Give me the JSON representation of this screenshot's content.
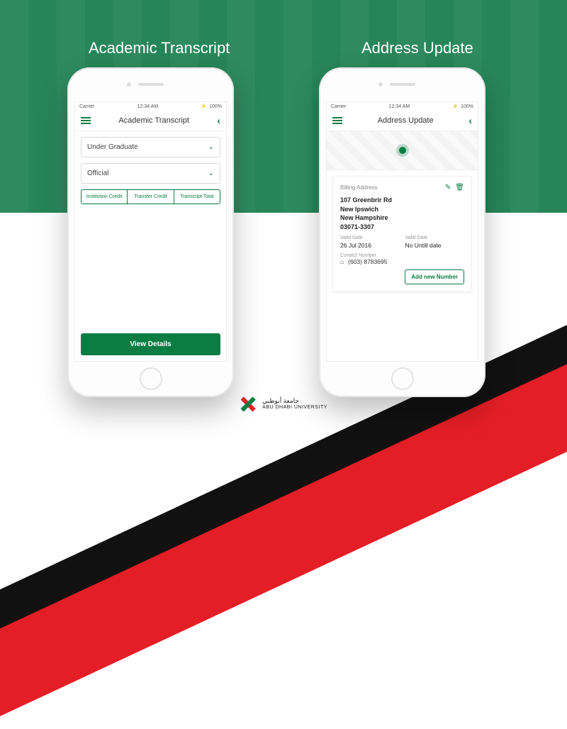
{
  "titles": {
    "left": "Academic Transcript",
    "right": "Address Update"
  },
  "status": {
    "carrier": "Carrier",
    "wifi": "ᯤ",
    "time": "12:34 AM",
    "bt": "⚡",
    "batt": "100%"
  },
  "screenA": {
    "nav_title": "Academic Transcript",
    "select1": "Under Graduate",
    "select2": "Official",
    "seg": [
      "Institution Credit",
      "Transfer Credit",
      "Transcript Total"
    ],
    "cta": "View Details"
  },
  "screenB": {
    "nav_title": "Address Update",
    "card_title": "Billing Address",
    "addr_lines": [
      "107 Greenbrir Rd",
      "New Ipswich",
      "New Hampshire",
      "03071-3307"
    ],
    "valid_lbl": "Valid Date",
    "valid_from": "26 Jul 2016",
    "valid_to": "No Untill date",
    "contact_lbl": "Conatct Number",
    "phone": "(603) 8783695",
    "add_btn": "Add new Number"
  },
  "footer": {
    "ar": "جامعة أبوظبي",
    "en": "ABU DHABI UNIVERSITY"
  }
}
